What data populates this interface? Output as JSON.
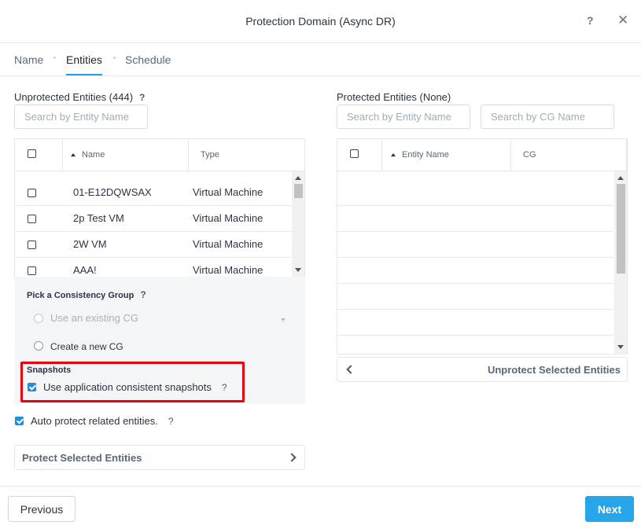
{
  "dialog": {
    "title": "Protection Domain (Async DR)",
    "help_label": "?",
    "close_label": "✕"
  },
  "tabs": [
    {
      "label": "Name",
      "active": false
    },
    {
      "label": "Entities",
      "active": true
    },
    {
      "label": "Schedule",
      "active": false
    }
  ],
  "unprotected": {
    "title": "Unprotected Entities (444)",
    "help": "?",
    "search_placeholder": "Search by Entity Name",
    "columns": [
      "Name",
      "Type"
    ],
    "rows": [
      {
        "name": "01-E12DQWSAX",
        "type": "Virtual Machine",
        "checked": false
      },
      {
        "name": "2p Test VM",
        "type": "Virtual Machine",
        "checked": false
      },
      {
        "name": "2W VM",
        "type": "Virtual Machine",
        "checked": false
      },
      {
        "name": "AAA!",
        "type": "Virtual Machine",
        "checked": false
      }
    ]
  },
  "consistency_group": {
    "title": "Pick a Consistency Group",
    "help": "?",
    "options": [
      {
        "label": "Use an existing CG",
        "disabled": true,
        "selected": false
      },
      {
        "label": "Create a new CG",
        "disabled": false,
        "selected": false
      }
    ]
  },
  "snapshots": {
    "title": "Snapshots",
    "label": "Use application consistent snapshots",
    "help": "?",
    "checked": true,
    "highlight_color": "#e8000e"
  },
  "auto_protect": {
    "label": "Auto protect related entities.",
    "help": "?",
    "checked": true
  },
  "protect_action": {
    "label": "Protect Selected Entities"
  },
  "protected": {
    "title": "Protected Entities (None)",
    "search_entity_placeholder": "Search by Entity Name",
    "search_cg_placeholder": "Search by CG Name",
    "columns": [
      "Entity Name",
      "CG"
    ]
  },
  "unprotect_action": {
    "label": "Unprotect Selected Entities"
  },
  "footer": {
    "previous_label": "Previous",
    "next_label": "Next"
  },
  "colors": {
    "accent": "#26a5eb",
    "tab_underline": "#1fa1e3",
    "checkbox": "#1d8ed8"
  }
}
